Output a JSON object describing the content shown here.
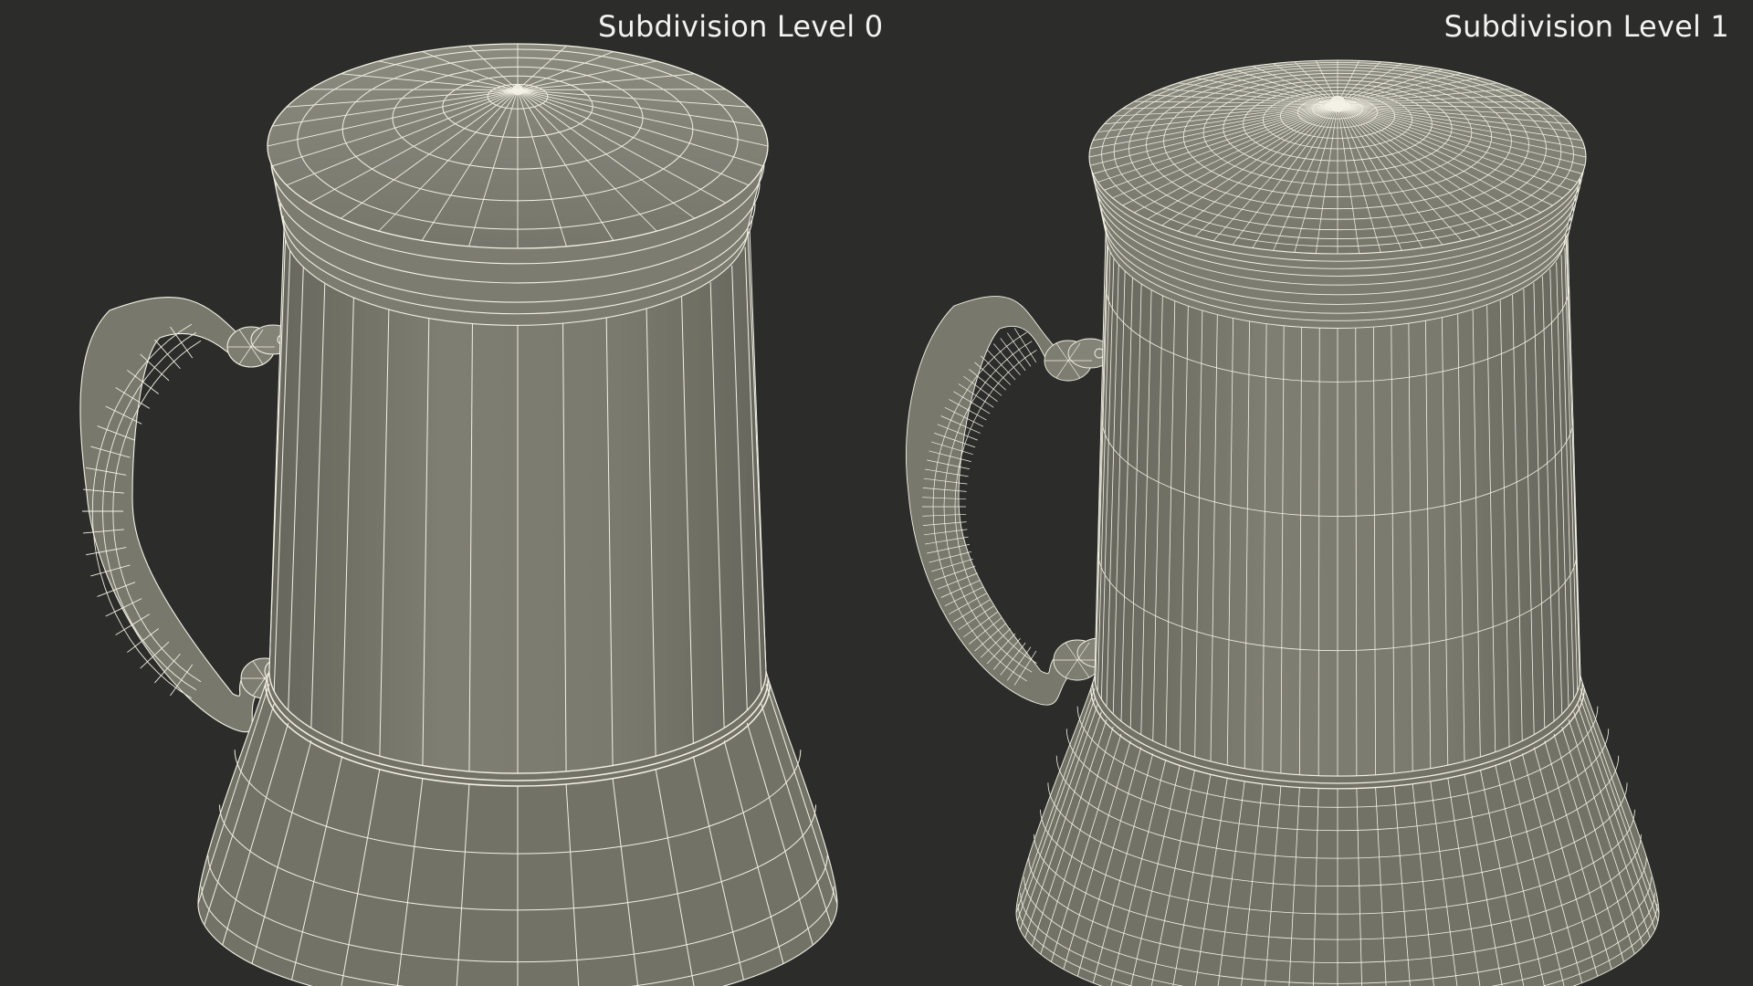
{
  "views": [
    {
      "label": "Subdivision Level 0",
      "subdivision_level": 0
    },
    {
      "label": "Subdivision Level 1",
      "subdivision_level": 1
    }
  ],
  "colors": {
    "background": "#2c2c2a",
    "body": "#7a7a6e",
    "body_light": "#8a8a7e",
    "body_dark": "#5f5f56",
    "wire": "#f4f2e6",
    "label": "#f2f2f0"
  }
}
